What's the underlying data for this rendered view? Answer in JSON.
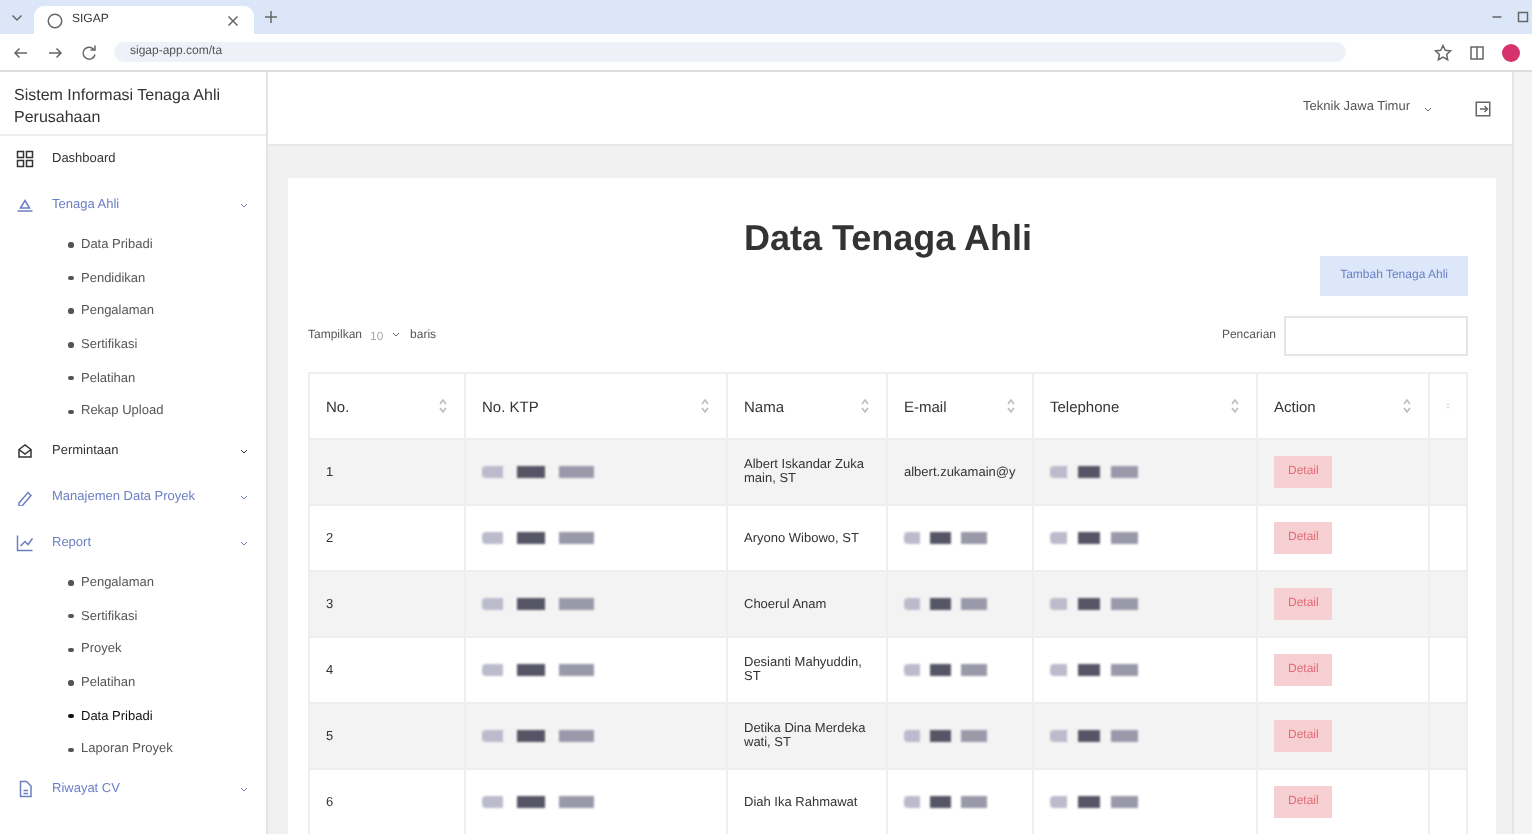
{
  "browser": {
    "tab_title": "SIGAP",
    "url": "sigap-app.com/ta"
  },
  "app": {
    "title": "Sistem Informasi Tenaga Ahli Perusahaan",
    "user": "Teknik Jawa Timur"
  },
  "sidebar": {
    "items": [
      {
        "label": "Dashboard",
        "kind": "link",
        "selected": false
      },
      {
        "label": "Tenaga Ahli",
        "kind": "group",
        "selected": true,
        "expanded": true,
        "children": [
          {
            "label": "Data Pribadi",
            "selected": false
          },
          {
            "label": "Pendidikan",
            "selected": false
          },
          {
            "label": "Pengalaman",
            "selected": false
          },
          {
            "label": "Sertifikasi",
            "selected": false
          },
          {
            "label": "Pelatihan",
            "selected": false
          },
          {
            "label": "Rekap Upload",
            "selected": false
          }
        ]
      },
      {
        "label": "Permintaan",
        "kind": "group",
        "selected": false
      },
      {
        "label": "Manajemen Data Proyek",
        "kind": "group",
        "selected": true
      },
      {
        "label": "Report",
        "kind": "group",
        "selected": true,
        "expanded": true,
        "children": [
          {
            "label": "Pengalaman",
            "selected": false
          },
          {
            "label": "Sertifikasi",
            "selected": false
          },
          {
            "label": "Proyek",
            "selected": false
          },
          {
            "label": "Pelatihan",
            "selected": false
          },
          {
            "label": "Data Pribadi",
            "selected": true
          },
          {
            "label": "Laporan Proyek",
            "selected": false
          }
        ]
      },
      {
        "label": "Riwayat CV",
        "kind": "group",
        "selected": true
      }
    ]
  },
  "page": {
    "title": "Data Tenaga Ahli",
    "add_button": "Tambah Tenaga Ahli",
    "show_label": "Tampilkan",
    "page_size": "10",
    "rows_label": "baris",
    "search_label": "Pencarian"
  },
  "table": {
    "columns": [
      "No.",
      "No. KTP",
      "Nama",
      "E-mail",
      "Telephone",
      "Action",
      ""
    ],
    "rows": [
      {
        "no": "1",
        "name": "Albert Iskandar Zukamain, ST",
        "email": "albert.zukamain@y",
        "action": "Detail"
      },
      {
        "no": "2",
        "name": "Aryono Wibowo, ST",
        "action": "Detail"
      },
      {
        "no": "3",
        "name": "Choerul Anam",
        "action": "Detail"
      },
      {
        "no": "4",
        "name": "Desianti Mahyuddin, ST",
        "action": "Detail"
      },
      {
        "no": "5",
        "name": "Detika Dina Merdekawati, ST",
        "action": "Detail"
      },
      {
        "no": "6",
        "name": "Diah Ika Rahmawat",
        "action": "Detail"
      }
    ]
  }
}
